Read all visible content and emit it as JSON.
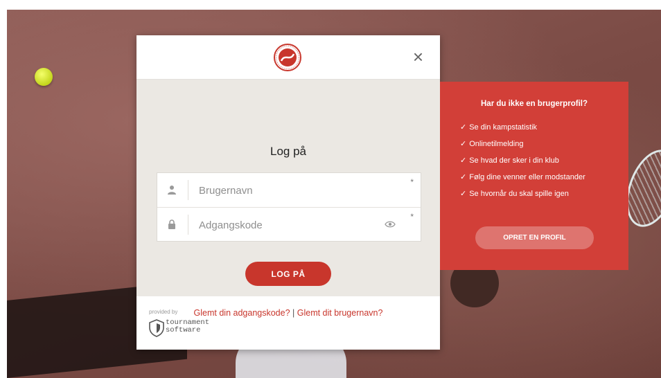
{
  "login": {
    "title": "Log på",
    "username_placeholder": "Brugernavn",
    "password_placeholder": "Adgangskode",
    "required_mark": "*",
    "submit_label": "LOG PÅ",
    "forgot_password": "Glemt din adgangskode?",
    "separator": "|",
    "forgot_username": "Glemt dit brugernavn?",
    "close_glyph": "×"
  },
  "footer": {
    "provided_by": "provided by",
    "brand_line1": "tournament",
    "brand_line2": "software"
  },
  "promo": {
    "title": "Har du ikke en brugerprofil?",
    "check_glyph": "✓",
    "items": [
      "Se din kampstatistik",
      "Onlinetilmelding",
      "Se hvad der sker i din klub",
      "Følg dine venner eller modstander",
      "Se hvornår du skal spille igen"
    ],
    "create_label": "OPRET EN PROFIL"
  },
  "colors": {
    "accent": "#c8362c",
    "promo_bg": "#d23f38",
    "body_bg": "#ebe8e3"
  },
  "icons": {
    "logo": "tennis-federation-logo",
    "close": "close-icon",
    "user": "user-icon",
    "lock": "lock-icon",
    "eye": "eye-icon",
    "brand": "tournament-software-shield-icon"
  }
}
